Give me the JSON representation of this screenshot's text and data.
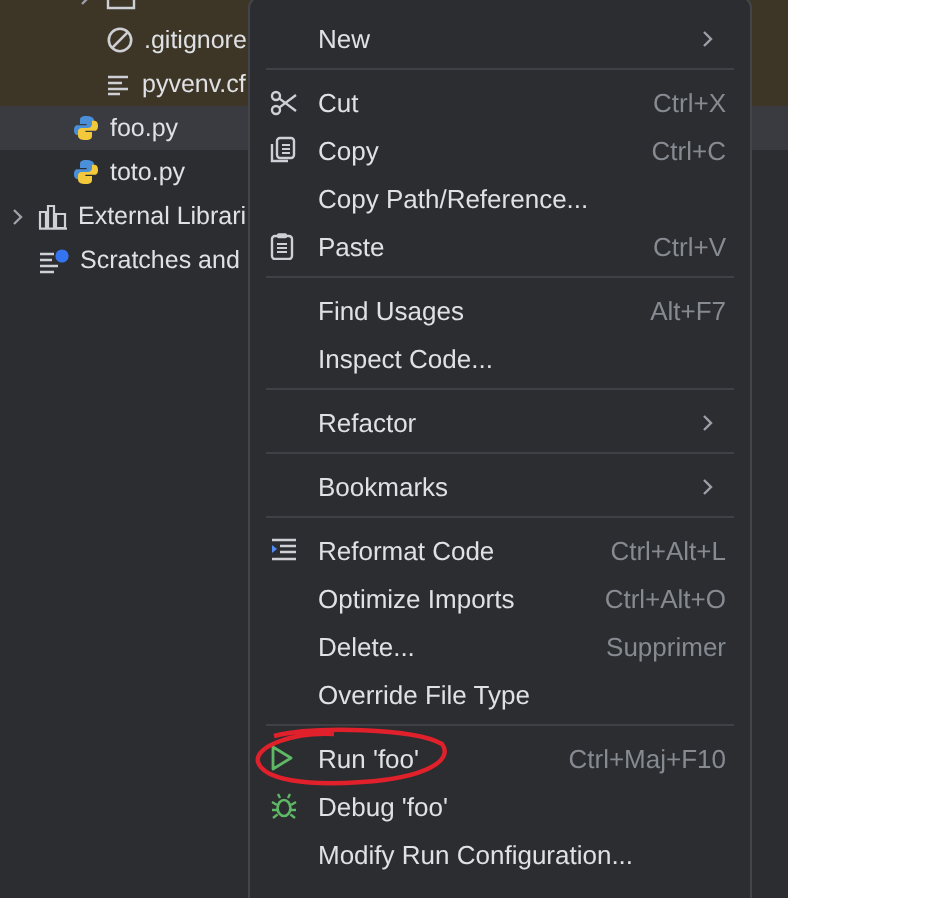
{
  "project_tree": {
    "items": [
      {
        "children": [
          {
            "excluded": true,
            "children": [
              {
                "kind": "folder",
                "expanded": false,
                "selected": false
              },
              {
                "label": ".gitignore",
                "kind": "ignore",
                "selected": false
              },
              {
                "label": "pyvenv.cf",
                "kind": "text",
                "selected": false
              }
            ]
          },
          {
            "label": "foo.py",
            "kind": "python",
            "selected": true
          },
          {
            "label": "toto.py",
            "kind": "python",
            "selected": false
          }
        ]
      },
      {
        "label": "External Librari",
        "kind": "library",
        "expanded": false,
        "selected": false
      },
      {
        "label": "Scratches and",
        "kind": "scratch",
        "selected": false
      }
    ]
  },
  "context_menu": {
    "items": [
      {
        "kind": "submenu",
        "label": "New"
      },
      {
        "kind": "separator"
      },
      {
        "kind": "item",
        "label": "Cut",
        "shortcut": "Ctrl+X"
      },
      {
        "kind": "item",
        "label": "Copy",
        "shortcut": "Ctrl+C"
      },
      {
        "kind": "item",
        "label": "Copy Path/Reference..."
      },
      {
        "kind": "item",
        "label": "Paste",
        "shortcut": "Ctrl+V"
      },
      {
        "kind": "separator"
      },
      {
        "kind": "item",
        "label": "Find Usages",
        "shortcut": "Alt+F7"
      },
      {
        "kind": "item",
        "label": "Inspect Code..."
      },
      {
        "kind": "separator"
      },
      {
        "kind": "submenu",
        "label": "Refactor"
      },
      {
        "kind": "separator"
      },
      {
        "kind": "submenu",
        "label": "Bookmarks"
      },
      {
        "kind": "separator"
      },
      {
        "kind": "item",
        "label": "Reformat Code",
        "shortcut": "Ctrl+Alt+L"
      },
      {
        "kind": "item",
        "label": "Optimize Imports",
        "shortcut": "Ctrl+Alt+O"
      },
      {
        "kind": "item",
        "label": "Delete...",
        "shortcut": "Supprimer"
      },
      {
        "kind": "item",
        "label": "Override File Type"
      },
      {
        "kind": "separator"
      },
      {
        "kind": "item",
        "label": "Run 'foo'",
        "shortcut": "Ctrl+Maj+F10",
        "circled": true
      },
      {
        "kind": "item",
        "label": "Debug 'foo'"
      },
      {
        "kind": "item",
        "label": "Modify Run Configuration..."
      }
    ]
  }
}
